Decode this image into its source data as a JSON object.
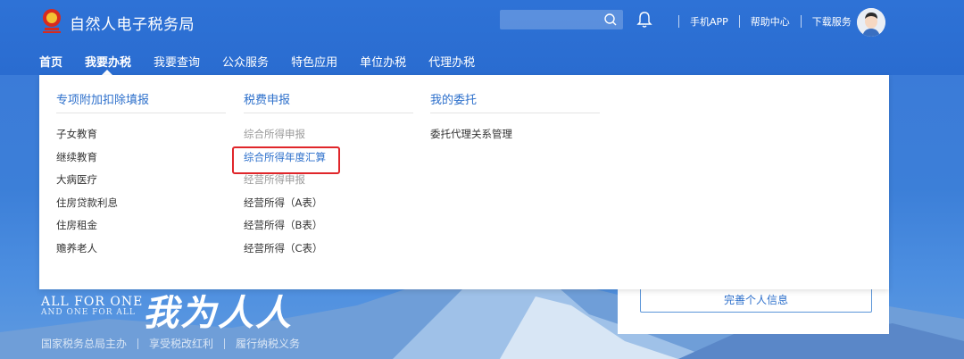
{
  "header": {
    "site_title": "自然人电子税务局",
    "search_placeholder": "",
    "links": [
      "手机APP",
      "帮助中心",
      "下载服务"
    ]
  },
  "nav": {
    "items": [
      "首页",
      "我要办税",
      "我要查询",
      "公众服务",
      "特色应用",
      "单位办税",
      "代理办税"
    ],
    "active_index": 1
  },
  "dropdown": {
    "columns": [
      {
        "heading": "专项附加扣除填报",
        "items": [
          {
            "label": "子女教育",
            "style": "normal"
          },
          {
            "label": "继续教育",
            "style": "normal"
          },
          {
            "label": "大病医疗",
            "style": "normal"
          },
          {
            "label": "住房贷款利息",
            "style": "normal"
          },
          {
            "label": "住房租金",
            "style": "normal"
          },
          {
            "label": "赡养老人",
            "style": "normal"
          }
        ]
      },
      {
        "heading": "税费申报",
        "items": [
          {
            "label": "综合所得申报",
            "style": "muted"
          },
          {
            "label": "综合所得年度汇算",
            "style": "active"
          },
          {
            "label": "经营所得申报",
            "style": "muted"
          },
          {
            "label": "经营所得（A表）",
            "style": "normal"
          },
          {
            "label": "经营所得（B表）",
            "style": "normal"
          },
          {
            "label": "经营所得（C表）",
            "style": "normal"
          }
        ]
      },
      {
        "heading": "我的委托",
        "items": [
          {
            "label": "委托代理关系管理",
            "style": "normal"
          }
        ]
      }
    ]
  },
  "banner": {
    "slogan_en_line1": "ALL FOR ONE",
    "slogan_en_line2": "AND ONE FOR ALL",
    "slogan_cn": "我为人人",
    "sub_items": [
      "国家税务总局主办",
      "享受税改红利",
      "履行纳税义务"
    ]
  },
  "profile_card": {
    "button_label": "完善个人信息"
  },
  "colors": {
    "header_blue": "#2e72d6",
    "link_blue": "#2c6fcb",
    "highlight_red": "#e0262a"
  }
}
